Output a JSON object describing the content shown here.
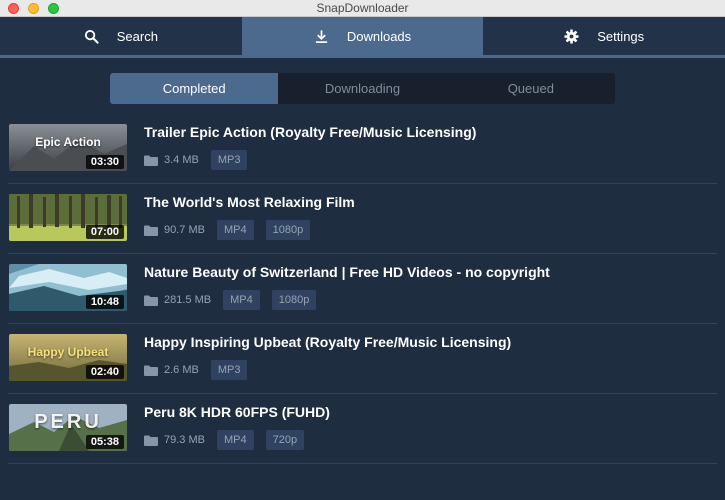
{
  "window": {
    "title": "SnapDownloader"
  },
  "nav": {
    "tabs": [
      {
        "label": "Search",
        "icon": "search-icon"
      },
      {
        "label": "Downloads",
        "icon": "download-icon",
        "active": true
      },
      {
        "label": "Settings",
        "icon": "gear-icon"
      }
    ]
  },
  "segments": [
    {
      "label": "Completed",
      "active": true
    },
    {
      "label": "Downloading"
    },
    {
      "label": "Queued"
    }
  ],
  "items": [
    {
      "title": "Trailer Epic Action (Royalty Free/Music Licensing)",
      "thumb_text": "Epic Action",
      "duration": "03:30",
      "size": "3.4 MB",
      "formats": [
        "MP3"
      ]
    },
    {
      "title": "The World's Most Relaxing Film",
      "thumb_text": "",
      "duration": "07:00",
      "size": "90.7 MB",
      "formats": [
        "MP4",
        "1080p"
      ]
    },
    {
      "title": "Nature Beauty of Switzerland | Free HD Videos - no copyright",
      "thumb_text": "",
      "duration": "10:48",
      "size": "281.5 MB",
      "formats": [
        "MP4",
        "1080p"
      ]
    },
    {
      "title": "Happy Inspiring Upbeat (Royalty Free/Music Licensing)",
      "thumb_text": "Happy Upbeat",
      "duration": "02:40",
      "size": "2.6 MB",
      "formats": [
        "MP3"
      ]
    },
    {
      "title": "Peru 8K HDR 60FPS (FUHD)",
      "thumb_text": "PERU",
      "duration": "05:38",
      "size": "79.3 MB",
      "formats": [
        "MP4",
        "720p"
      ]
    }
  ],
  "colors": {
    "background": "#1f2d40",
    "accent": "#4b6a8e",
    "badge": "#2f4360",
    "muted_text": "#95a3b3"
  }
}
